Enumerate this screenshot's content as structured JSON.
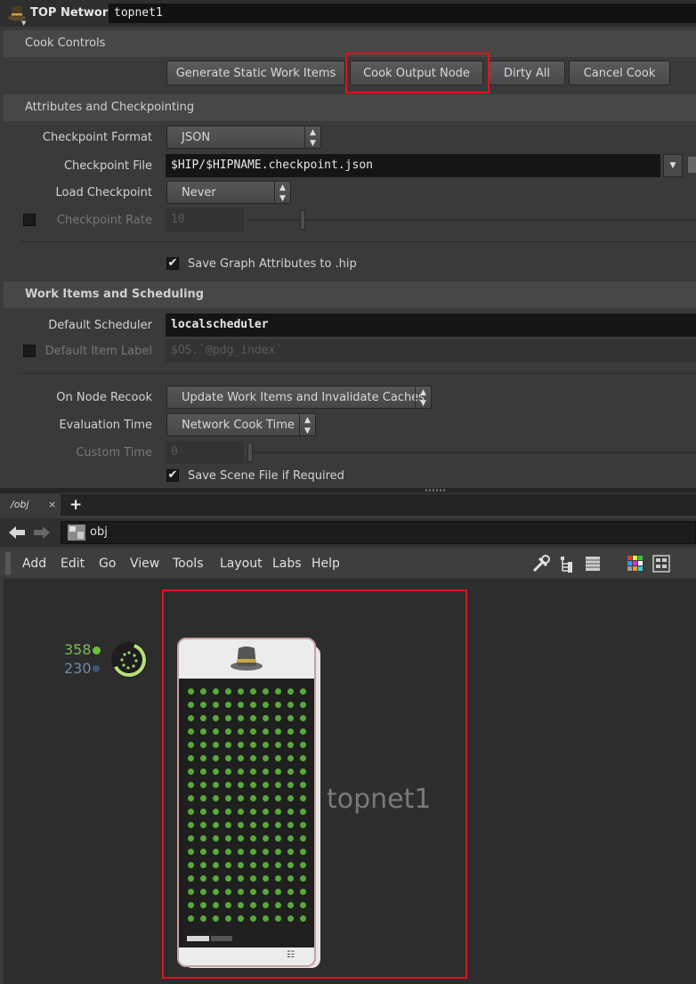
{
  "header": {
    "title": "TOP Network",
    "node_name": "topnet1"
  },
  "cook_controls": {
    "section_label": "Cook Controls",
    "generate_static": "Generate Static Work Items",
    "cook_output": "Cook Output Node",
    "dirty_all": "Dirty All",
    "cancel_cook": "Cancel Cook"
  },
  "attributes": {
    "section_label": "Attributes and Checkpointing",
    "checkpoint_format_label": "Checkpoint Format",
    "checkpoint_format_value": "JSON",
    "checkpoint_file_label": "Checkpoint File",
    "checkpoint_file_value": "$HIP/$HIPNAME.checkpoint.json",
    "load_checkpoint_label": "Load Checkpoint",
    "load_checkpoint_value": "Never",
    "checkpoint_rate_label": "Checkpoint Rate",
    "checkpoint_rate_value": "10",
    "save_graph_label": "Save Graph Attributes to .hip"
  },
  "work_items": {
    "section_label": "Work Items and Scheduling",
    "default_scheduler_label": "Default Scheduler",
    "default_scheduler_value": "localscheduler",
    "default_item_label_label": "Default Item Label",
    "default_item_label_value": "$OS.`@pdg_index`",
    "on_node_recook_label": "On Node Recook",
    "on_node_recook_value": "Update Work Items and Invalidate Caches",
    "evaluation_time_label": "Evaluation Time",
    "evaluation_time_value": "Network Cook Time",
    "custom_time_label": "Custom Time",
    "custom_time_value": "0",
    "save_scene_label": "Save Scene File if Required"
  },
  "network": {
    "tab_label": "/obj",
    "tab_close": "×",
    "add_tab": "+",
    "path": "obj",
    "menu": [
      "Add",
      "Edit",
      "Go",
      "View",
      "Tools",
      "Layout",
      "Labs",
      "Help"
    ],
    "node_label": "topnet1",
    "count_green": "358",
    "count_blue": "230"
  },
  "colors": {
    "highlight": "#e0141c",
    "work_item_green": "#59a83a",
    "count_green": "#7bb85c",
    "count_blue": "#6f8aa8"
  }
}
